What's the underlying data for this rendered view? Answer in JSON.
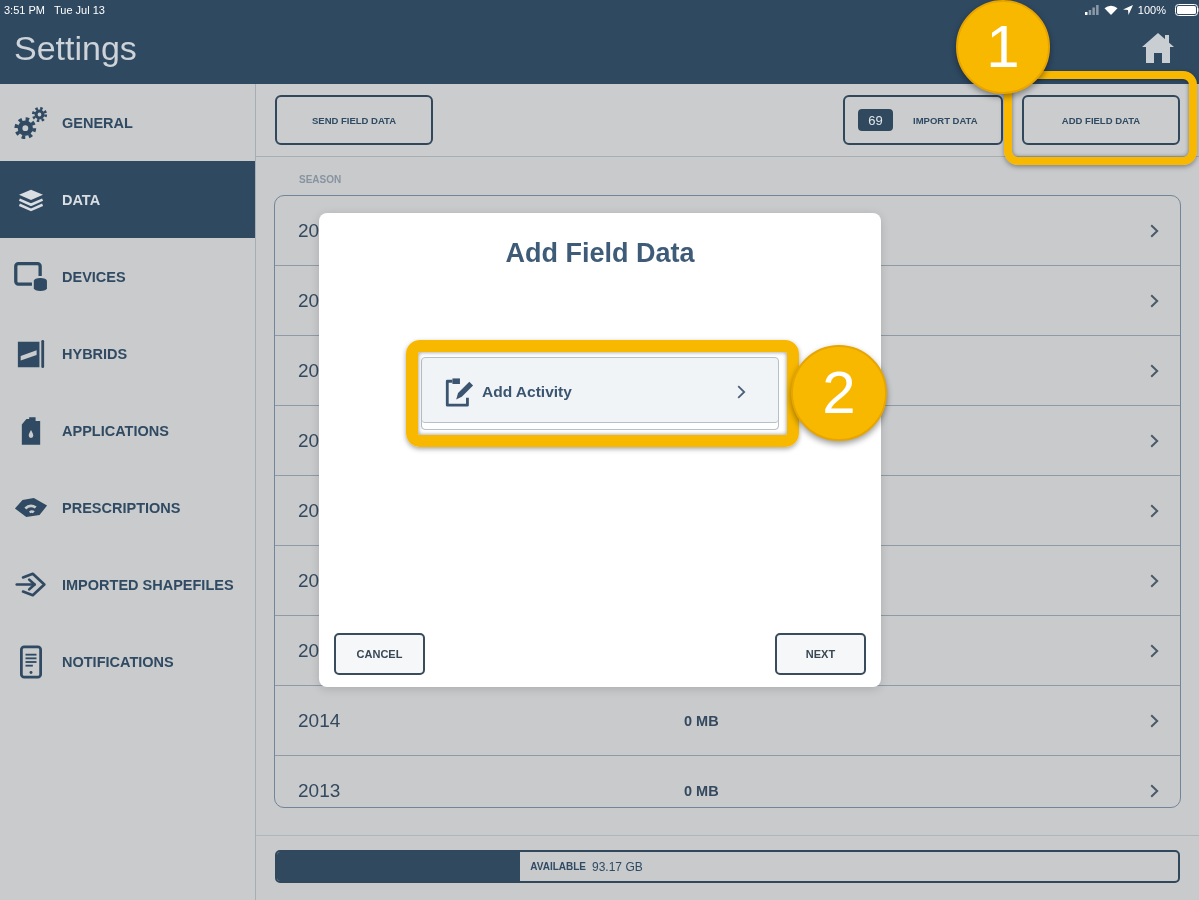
{
  "status_bar": {
    "time": "3:51 PM",
    "date": "Tue Jul 13",
    "battery": "100%"
  },
  "header": {
    "title": "Settings"
  },
  "sidebar": {
    "items": [
      {
        "label": "GENERAL",
        "selected": false
      },
      {
        "label": "DATA",
        "selected": true
      },
      {
        "label": "DEVICES",
        "selected": false
      },
      {
        "label": "HYBRIDS",
        "selected": false
      },
      {
        "label": "APPLICATIONS",
        "selected": false
      },
      {
        "label": "PRESCRIPTIONS",
        "selected": false
      },
      {
        "label": "IMPORTED SHAPEFILES",
        "selected": false
      },
      {
        "label": "NOTIFICATIONS",
        "selected": false
      }
    ]
  },
  "toolbar": {
    "buttons": [
      {
        "kind": "plain",
        "label": "SEND FIELD DATA"
      },
      {
        "kind": "count",
        "count": "69",
        "label": "IMPORT DATA"
      },
      {
        "kind": "plain",
        "label": "ADD FIELD DATA",
        "callout": "1"
      }
    ]
  },
  "table": {
    "column_header": "SEASON",
    "rows": [
      {
        "season": "20"
      },
      {
        "season": "20"
      },
      {
        "season": "20"
      },
      {
        "season": "20"
      },
      {
        "season": "20"
      },
      {
        "season": "20"
      },
      {
        "season": "20"
      },
      {
        "season": "2014",
        "size": "0 MB"
      },
      {
        "season": "2013",
        "size": "0 MB"
      }
    ]
  },
  "storage": {
    "level": 0.27,
    "label": "AVAILABLE",
    "value": "93.17 GB"
  },
  "dialog": {
    "title": "Add Field Data",
    "options": [
      {
        "label": "Add Activity",
        "callout": "2"
      }
    ],
    "buttons": [
      {
        "label": "CANCEL"
      },
      {
        "label": "NEXT"
      }
    ]
  }
}
